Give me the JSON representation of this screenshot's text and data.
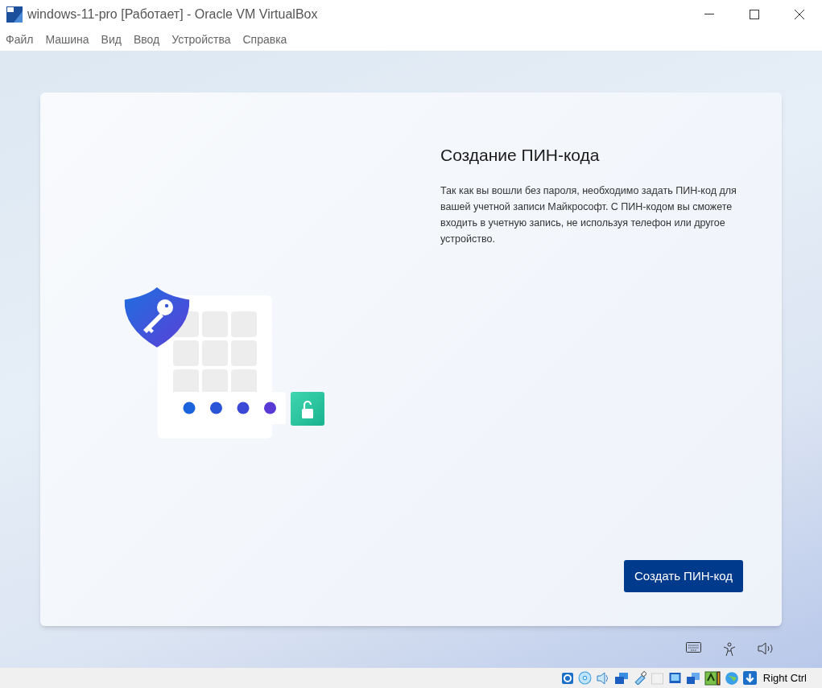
{
  "window": {
    "title": "windows-11-pro [Работает] - Oracle VM VirtualBox"
  },
  "menu": [
    "Файл",
    "Машина",
    "Вид",
    "Ввод",
    "Устройства",
    "Справка"
  ],
  "setup": {
    "heading": "Создание ПИН-кода",
    "body": "Так как вы вошли без пароля, необходимо задать ПИН-код для вашей учетной записи Майкрософт. С ПИН-кодом вы сможете входить в учетную запись, не используя телефон или другое устройство.",
    "button": "Создать ПИН-код"
  },
  "status_bar": {
    "host_key": "Right Ctrl"
  }
}
